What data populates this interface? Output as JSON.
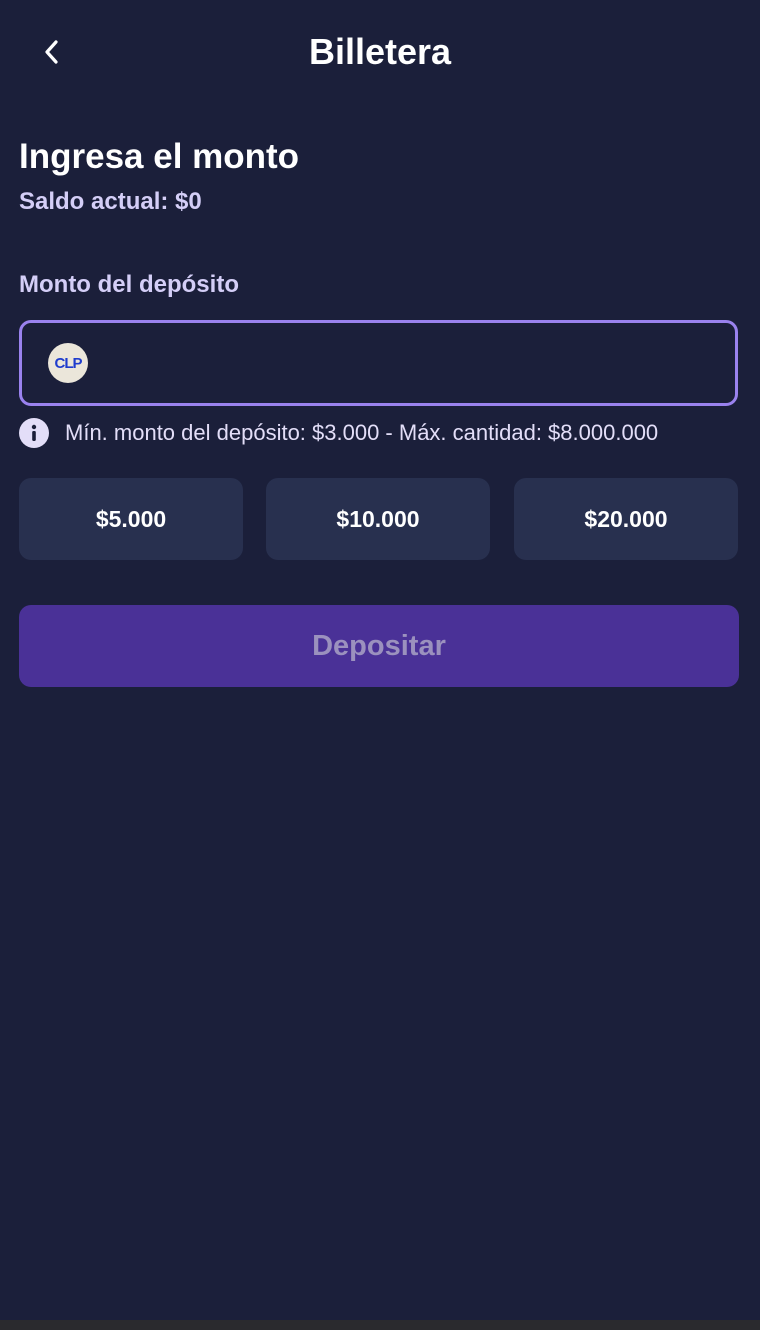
{
  "header": {
    "title": "Billetera"
  },
  "deposit": {
    "section_title": "Ingresa el monto",
    "balance_text": "Saldo actual: $0",
    "field_label": "Monto del depósito",
    "amount_value": "",
    "currency_badge": "CLP",
    "limits_text": "Mín. monto del depósito: $3.000 - Máx. cantidad: $8.000.000",
    "quick_amounts": [
      "$5.000",
      "$10.000",
      "$20.000"
    ],
    "submit_label": "Depositar"
  },
  "colors": {
    "background": "#1b1f3a",
    "field_border": "#9a82ee",
    "quick_button_bg": "#28304f",
    "submit_button_bg": "#4a3197",
    "submit_text_disabled": "#9b91be",
    "label_text": "#d4cef7"
  },
  "icons": {
    "back": "chevron-left-icon",
    "currency": "clp-currency-icon",
    "info": "info-icon"
  }
}
